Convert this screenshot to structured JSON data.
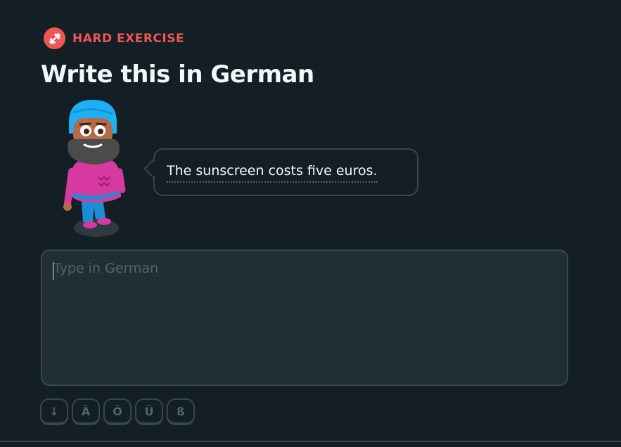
{
  "badge": {
    "label": "HARD EXERCISE",
    "icon": "dumbbell-icon",
    "color": "#ee5555"
  },
  "title": "Write this in German",
  "prompt": {
    "text": "The sunscreen costs five euros."
  },
  "answer": {
    "value": "",
    "placeholder": "Type in German"
  },
  "special_keys": [
    {
      "label": "↓"
    },
    {
      "label": "Ä"
    },
    {
      "label": "Ö"
    },
    {
      "label": "Ü"
    },
    {
      "label": "ß"
    }
  ],
  "colors": {
    "background": "#131f24",
    "text": "#f1f7fb",
    "border": "#37464f",
    "input_bg": "#202f36",
    "muted": "#52656d"
  }
}
